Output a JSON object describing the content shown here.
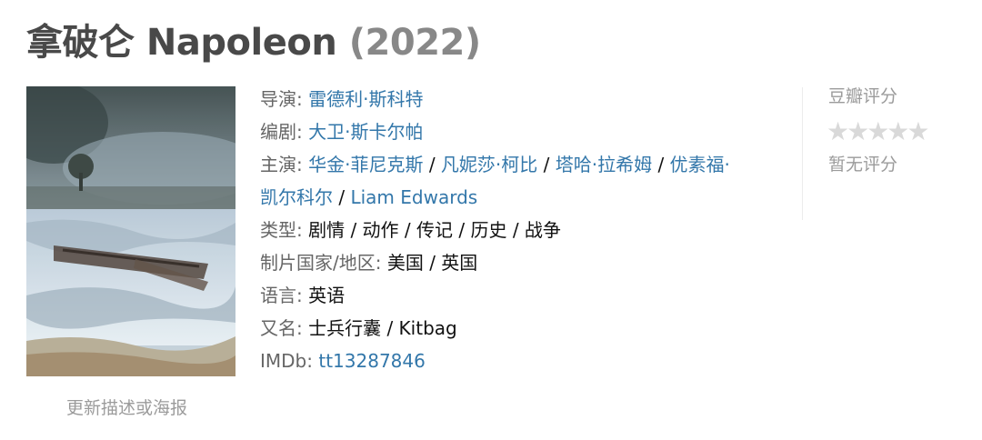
{
  "header": {
    "title": "拿破仑 Napoleon",
    "year": "(2022)"
  },
  "poster": {
    "update_link": "更新描述或海报"
  },
  "info": {
    "director_label": "导演",
    "director": "雷德利·斯科特",
    "writer_label": "编剧",
    "writer": "大卫·斯卡尔帕",
    "cast_label": "主演",
    "cast": [
      "华金·菲尼克斯",
      "凡妮莎·柯比",
      "塔哈·拉希姆",
      "优素福·",
      "凯尔科尔",
      "Liam Edwards"
    ],
    "genre_label": "类型",
    "genre": "剧情 / 动作 / 传记 / 历史 / 战争",
    "region_label": "制片国家/地区",
    "region": "美国 / 英国",
    "language_label": "语言",
    "language": "英语",
    "aka_label": "又名",
    "aka": "士兵行囊 / Kitbag",
    "imdb_label": "IMDb",
    "imdb": "tt13287846"
  },
  "rating": {
    "title": "豆瓣评分",
    "stars": "★★★★★",
    "no_rating": "暂无评分"
  },
  "colors": {
    "link": "#3377aa",
    "label": "#666666",
    "muted": "#9b9b9b",
    "title": "#494949"
  }
}
